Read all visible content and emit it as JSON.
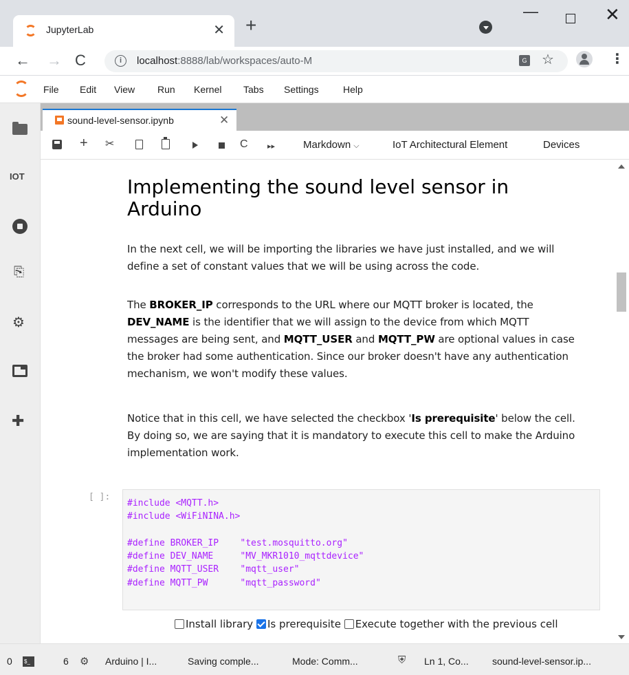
{
  "browser": {
    "tab_title": "JupyterLab",
    "tab_close": "✕",
    "new_tab": "+",
    "window_min": "—",
    "window_close": "✕",
    "url_host": "localhost",
    "url_path": ":8888/lab/workspaces/auto-M",
    "back": "←",
    "forward": "→",
    "reload": "C",
    "info": "i",
    "star": "☆",
    "menu": "⋮"
  },
  "menubar": {
    "items": [
      "File",
      "Edit",
      "View",
      "Run",
      "Kernel",
      "Tabs",
      "Settings",
      "Help"
    ]
  },
  "sidebar": {
    "iot_label": "IOT",
    "commands_glyph": "⎘",
    "gears_glyph": "⚙",
    "extension_glyph": "✚"
  },
  "document_tab": {
    "title": "sound-level-sensor.ipynb",
    "close": "✕"
  },
  "notebook_toolbar": {
    "add": "+",
    "cut": "✂",
    "restart": "C",
    "fast_forward": "▸▸",
    "cell_type": "Markdown",
    "cell_type_chevron": "⌵",
    "iot_element": "IoT Architectural Element",
    "devices": "Devices"
  },
  "notebook": {
    "heading": "Implementing the sound level sensor in Arduino",
    "p1": "In the next cell, we will be importing the libraries we have just installed, and we will define a set of constant values that we will be using across the code.",
    "p2": {
      "t1": "The ",
      "b1": "BROKER_IP",
      "t2": " corresponds to the URL where our MQTT broker is located, the ",
      "b2": "DEV_NAME",
      "t3": " is the identifier that we will assign to the device from which MQTT messages are being sent, and ",
      "b3": "MQTT_USER",
      "t4": " and ",
      "b4": "MQTT_PW",
      "t5": " are optional values in case the broker had some authentication. Since our broker doesn't have any authentication mechanism, we won't modify these values."
    },
    "p3": {
      "t1": "Notice that in this cell, we have selected the checkbox '",
      "b1": "Is prerequisite",
      "t2": "' below the cell. By doing so, we are saying that it is mandatory to execute this cell to make the Arduino implementation work."
    },
    "prompt": "[ ]:",
    "code_lines": [
      {
        "kw": "#include <MQTT.h>",
        "str": ""
      },
      {
        "kw": "#include <WiFiNINA.h>",
        "str": ""
      },
      {
        "kw": "",
        "str": ""
      },
      {
        "kw": "#define BROKER_IP    ",
        "str": "\"test.mosquitto.org\""
      },
      {
        "kw": "#define DEV_NAME     ",
        "str": "\"MV_MKR1010_mqttdevice\""
      },
      {
        "kw": "#define MQTT_USER    ",
        "str": "\"mqtt_user\""
      },
      {
        "kw": "#define MQTT_PW      ",
        "str": "\"mqtt_password\""
      }
    ],
    "options": {
      "install_library": "Install library",
      "install_library_checked": false,
      "is_prerequisite": "Is prerequisite",
      "is_prerequisite_checked": true,
      "execute_together": "Execute together with the previous cell",
      "execute_together_checked": false
    }
  },
  "statusbar": {
    "count_a": "0",
    "terminal_glyph": "$_",
    "count_b": "6",
    "cpu_glyph": "⚙",
    "kernel": "Arduino | I...",
    "saving": "Saving comple...",
    "mode": "Mode: Comm...",
    "shield_glyph": "⛨",
    "position": "Ln 1, Co...",
    "filename": "sound-level-sensor.ip..."
  },
  "colors": {
    "accent": "#1976d2",
    "jupyter_orange": "#f37726",
    "code_keyword": "#aa22ff",
    "checkbox_checked": "#1a73e8"
  }
}
